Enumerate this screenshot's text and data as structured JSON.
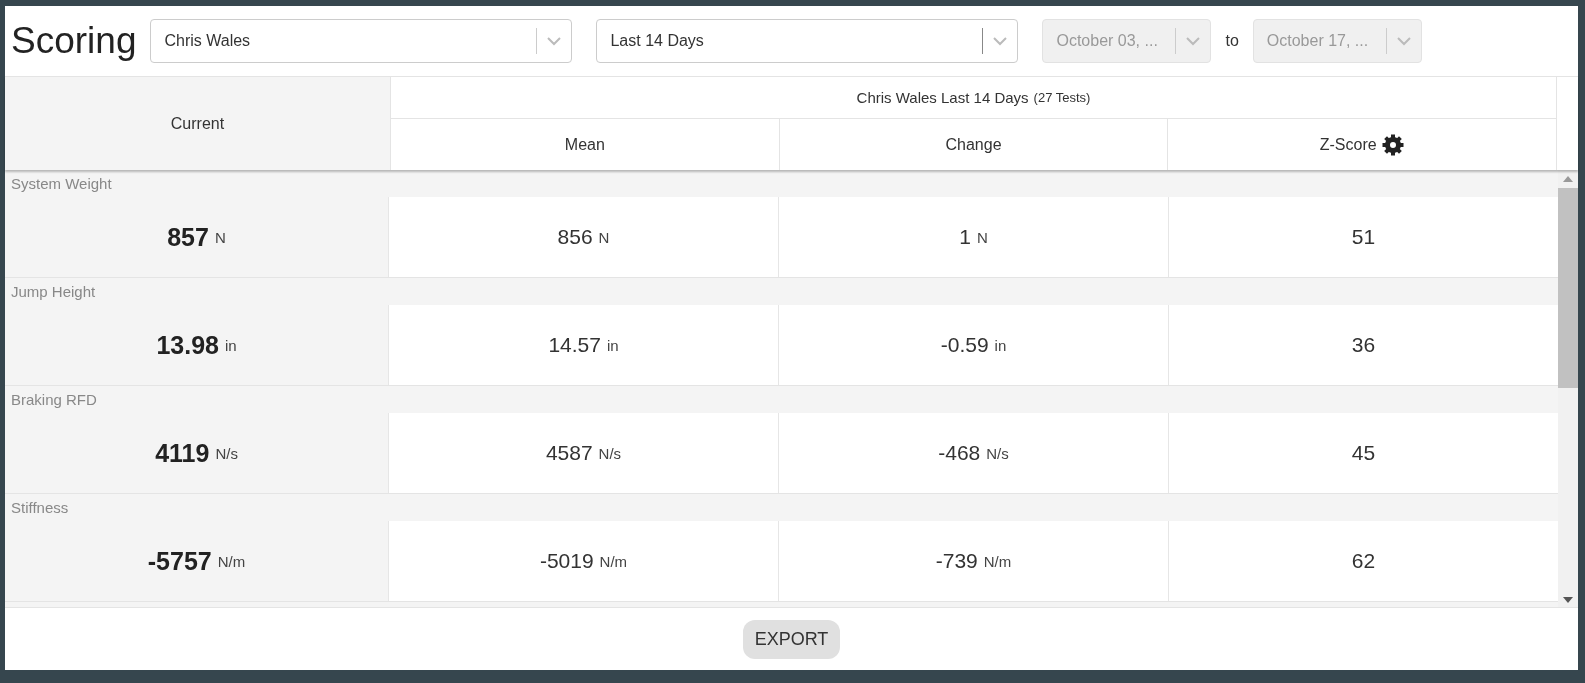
{
  "title": "Scoring",
  "athlete_select": {
    "value": "Chris Wales"
  },
  "range_select": {
    "value": "Last 14 Days"
  },
  "date_from": {
    "value": "October 03, ...",
    "disabled": true
  },
  "to_label": "to",
  "date_to": {
    "value": "October 17, ...",
    "disabled": true
  },
  "table": {
    "current_header": "Current",
    "group_header": {
      "title": "Chris Wales Last 14 Days",
      "count": "(27 Tests)"
    },
    "columns": [
      "Mean",
      "Change",
      "Z-Score"
    ],
    "metrics": [
      {
        "name": "System Weight",
        "current": {
          "value": "857",
          "unit": "N"
        },
        "mean": {
          "value": "856",
          "unit": "N"
        },
        "change": {
          "value": "1",
          "unit": "N"
        },
        "z_score": "51"
      },
      {
        "name": "Jump Height",
        "current": {
          "value": "13.98",
          "unit": "in"
        },
        "mean": {
          "value": "14.57",
          "unit": "in"
        },
        "change": {
          "value": "-0.59",
          "unit": "in"
        },
        "z_score": "36"
      },
      {
        "name": "Braking RFD",
        "current": {
          "value": "4119",
          "unit": "N/s"
        },
        "mean": {
          "value": "4587",
          "unit": "N/s"
        },
        "change": {
          "value": "-468",
          "unit": "N/s"
        },
        "z_score": "45"
      },
      {
        "name": "Stiffness",
        "current": {
          "value": "-5757",
          "unit": "N/m"
        },
        "mean": {
          "value": "-5019",
          "unit": "N/m"
        },
        "change": {
          "value": "-739",
          "unit": "N/m"
        },
        "z_score": "62"
      }
    ]
  },
  "export_button": "EXPORT"
}
